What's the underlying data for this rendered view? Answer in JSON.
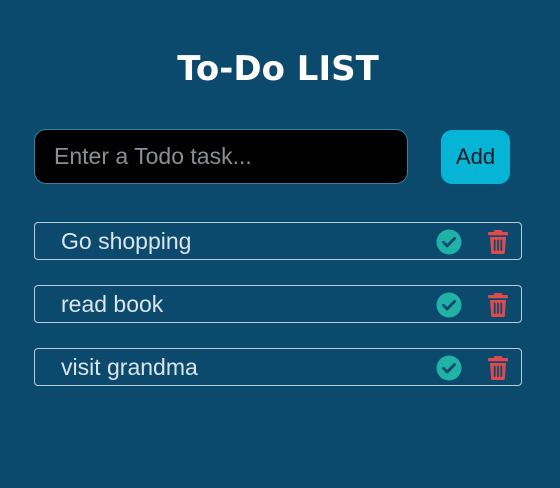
{
  "header": {
    "title": "To-Do LIST"
  },
  "form": {
    "input_value": "",
    "input_placeholder": "Enter a Todo task...",
    "add_label": "Add"
  },
  "todos": [
    {
      "text": "Go shopping"
    },
    {
      "text": "read book"
    },
    {
      "text": "visit grandma"
    }
  ],
  "icons": {
    "complete": "check-circle-icon",
    "delete": "trash-icon"
  },
  "colors": {
    "background": "#0b4a6c",
    "accent": "#06b4d6",
    "complete": "#20b2a6",
    "delete": "#e04a4f"
  }
}
